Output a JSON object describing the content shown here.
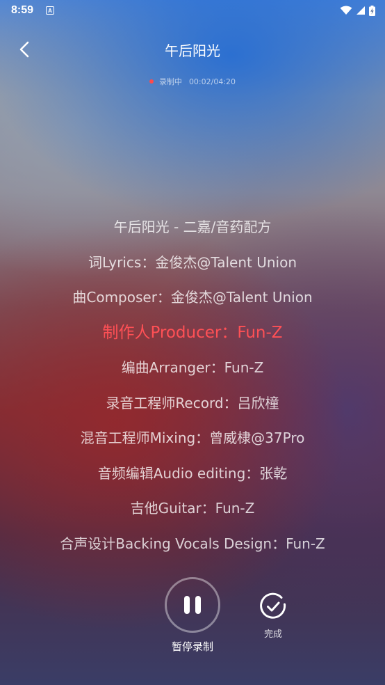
{
  "status_bar": {
    "time": "8:59",
    "notification_icon": "A"
  },
  "header": {
    "title": "午后阳光",
    "back_icon": "chevron-left-icon"
  },
  "recording": {
    "status_label": "录制中",
    "elapsed": "00:02",
    "total": "04:20",
    "time_text": "00:02/04:20",
    "dot_color": "#ff4a4a"
  },
  "lyrics": {
    "lines": [
      "午后阳光 - 二嘉/音药配方",
      "词Lyrics：金俊杰@Talent Union",
      "曲Composer：金俊杰@Talent Union",
      "制作人Producer：Fun-Z",
      "编曲Arranger：Fun-Z",
      "录音工程师Record：吕欣橦",
      "混音工程师Mixing：曾威棣@37Pro",
      "音频编辑Audio editing：张乾",
      "吉他Guitar：Fun-Z",
      "合声设计Backing Vocals Design：Fun-Z"
    ],
    "active_index": 3,
    "active_color": "#ff5055"
  },
  "controls": {
    "pause_label": "暂停录制",
    "done_label": "完成"
  }
}
